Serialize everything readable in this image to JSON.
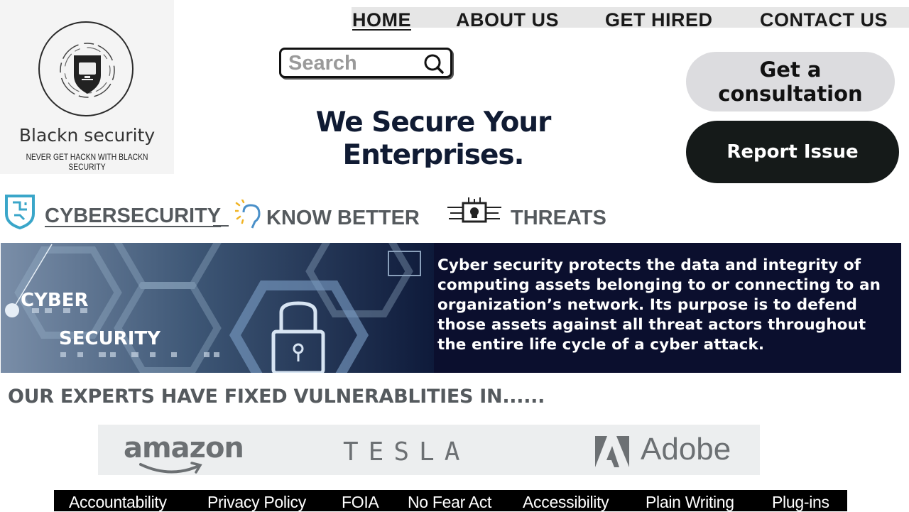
{
  "brand": {
    "name": "Blackn security",
    "tagline": "NEVER GET HACKN WITH BLACKN SECURITY"
  },
  "nav": {
    "items": [
      {
        "label": "HOME",
        "active": true
      },
      {
        "label": "ABOUT US",
        "active": false
      },
      {
        "label": "GET HIRED",
        "active": false
      },
      {
        "label": "CONTACT US",
        "active": false
      }
    ]
  },
  "search": {
    "placeholder": "Search",
    "value": ""
  },
  "hero": {
    "line1": "We Secure Your",
    "line2": "Enterprises."
  },
  "actions": {
    "consultation": "Get a consultation",
    "report": "Report Issue"
  },
  "categories": [
    {
      "label": "CYBERSECURITY",
      "icon": "shield-circuit-icon"
    },
    {
      "label": "KNOW BETTER",
      "icon": "lightbulb-icon"
    },
    {
      "label": "THREATS",
      "icon": "skull-chip-icon"
    }
  ],
  "banner": {
    "word1": "CYBER",
    "word2": "SECURITY",
    "description": "Cyber security protects the data and integrity of computing assets belonging to or connecting to an organization’s network. Its purpose is to defend those assets against all threat actors throughout the entire life cycle of a cyber attack."
  },
  "experts": {
    "heading": "OUR EXPERTS HAVE FIXED VULNERABLITIES IN......"
  },
  "clients": [
    "amazon",
    "TESLA",
    "Adobe"
  ],
  "footer": {
    "links": [
      "Accountability",
      "Privacy Policy",
      "FOIA",
      "No Fear Act",
      "Accessibility",
      "Plain Writing",
      "Plug-ins"
    ]
  },
  "colors": {
    "banner_bg": "#0b0f2e",
    "hero_text": "#101b33",
    "report_button": "#151a19",
    "consult_button": "#dcdcdf",
    "nav_bar": "#e6e6e6"
  }
}
